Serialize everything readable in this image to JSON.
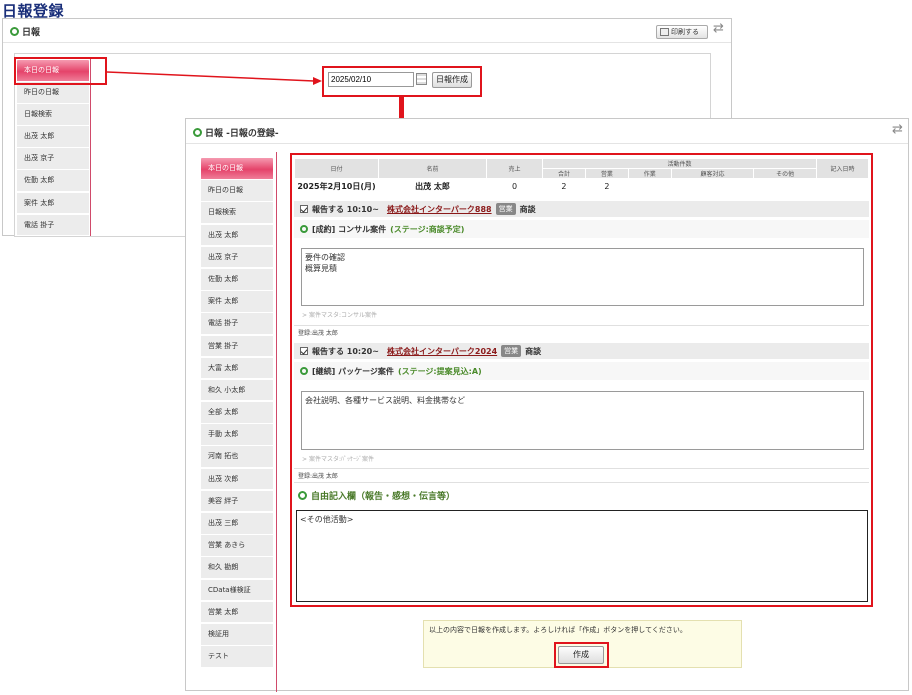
{
  "page_title": "日報登録",
  "back_window": {
    "title": "日報",
    "print_label": "印刷する",
    "sidebar": [
      "本日の日報",
      "昨日の日報",
      "日報検索",
      "出茂 太郎",
      "出茂 京子",
      "佐勤 太郎",
      "案件 太郎",
      "電話 掛子"
    ],
    "date_value": "2025/02/10",
    "create_report_label": "日報作成"
  },
  "front_window": {
    "title": "日報 -日報の登録-",
    "sidebar": [
      "本日の日報",
      "昨日の日報",
      "日報検索",
      "出茂 太郎",
      "出茂 京子",
      "佐勤 太郎",
      "案件 太郎",
      "電話 掛子",
      "営業 掛子",
      "大富 太郎",
      "和久 小太郎",
      "全部 太郎",
      "手動 太郎",
      "河南 拓也",
      "出茂 次郎",
      "美容 絆子",
      "出茂 三郎",
      "営業 あきら",
      "和久 勘朗",
      "CData様検証",
      "営業 太郎",
      "検証用",
      "テスト"
    ]
  },
  "summary": {
    "headers": {
      "date": "日付",
      "name": "名前",
      "sales": "売上",
      "activity": "活動件数",
      "entry_time": "記入日時",
      "sub": [
        "合計",
        "営業",
        "作業",
        "顧客対応",
        "その他"
      ]
    },
    "row": {
      "date": "2025年2月10日(月)",
      "name": "出茂 太郎",
      "sales": "0",
      "total": "2",
      "eigyo": "2",
      "sagyo": "",
      "kokyaku": "",
      "sonota": "",
      "entry_time": ""
    }
  },
  "entries": [
    {
      "head": "報告する 10:10~",
      "company": "株式会社インターパーク888",
      "tag": "営業",
      "type": "商談",
      "case_title": "[成約] コンサル案件",
      "stage": "(ステージ:商談予定)",
      "notes": [
        "要件の確認",
        "概算見積"
      ],
      "master": "案件マスタ:コンサル案件",
      "registered": "登録:出茂 太郎"
    },
    {
      "head": "報告する 10:20~",
      "company": "株式会社インターパーク2024",
      "tag": "営業",
      "type": "商談",
      "case_title": "[継続] パッケージ案件",
      "stage": "(ステージ:提案見込:A)",
      "notes": [
        "会社説明、各種サービス説明、料金携帯など"
      ],
      "master": "案件マスタ:ﾊﾟｯｹｰｼﾞ案件",
      "registered": "登録:出茂 太郎"
    }
  ],
  "free_entry": {
    "label": "自由記入欄（報告・感想・伝言等）",
    "value": "<その他活動>"
  },
  "notice": "以上の内容で日報を作成します。よろしければ「作成」ボタンを押してください。",
  "create_label": "作成",
  "colors": {
    "accent_red": "#e0141c",
    "title_blue": "#1a2f7a",
    "sidebar_active": "#e5436a"
  }
}
